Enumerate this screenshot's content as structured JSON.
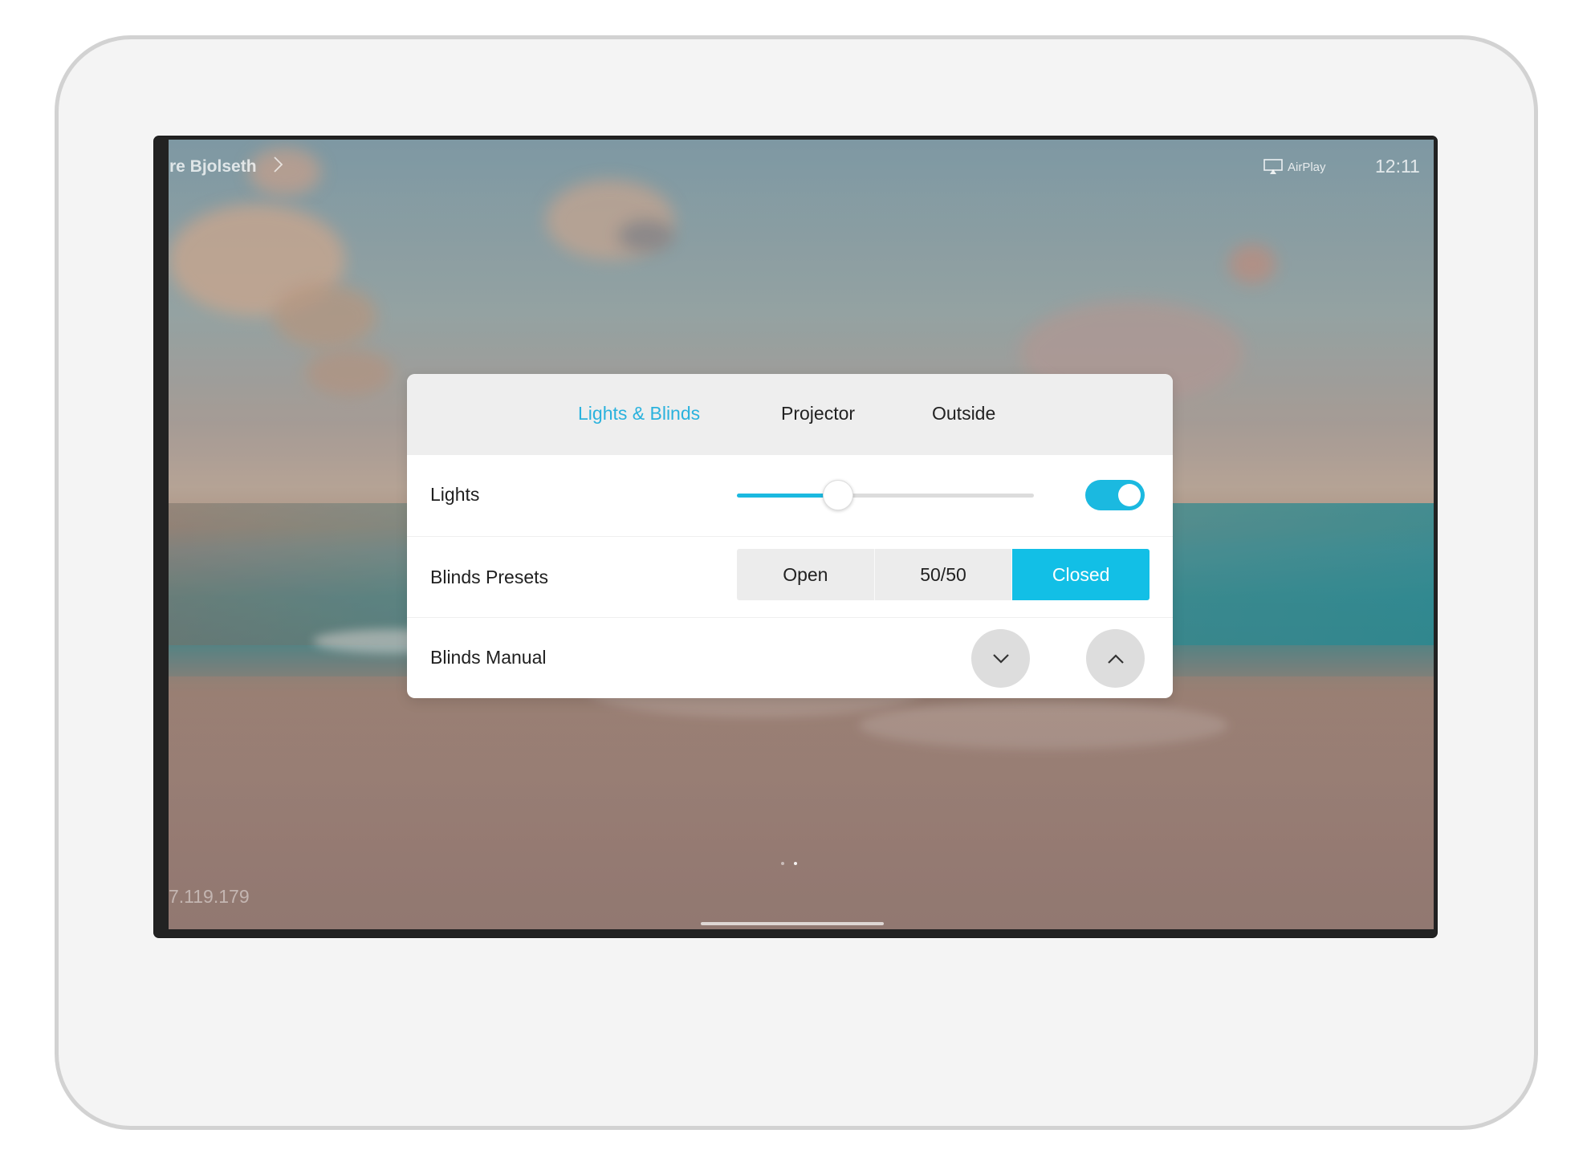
{
  "status_bar": {
    "user_name": "re Bjolseth",
    "airplay_label": "AirPlay",
    "time": "12:11",
    "ip_address": "7.119.179"
  },
  "panel": {
    "tabs": [
      {
        "label": "Lights & Blinds",
        "active": true
      },
      {
        "label": "Projector",
        "active": false
      },
      {
        "label": "Outside",
        "active": false
      }
    ],
    "lights": {
      "label": "Lights",
      "level_fraction": 0.34,
      "switch_on": true
    },
    "blinds_presets": {
      "label": "Blinds Presets",
      "options": [
        "Open",
        "50/50",
        "Closed"
      ],
      "selected": "Closed"
    },
    "blinds_manual": {
      "label": "Blinds Manual",
      "down_icon": "chevron-down-icon",
      "up_icon": "chevron-up-icon"
    }
  },
  "colors": {
    "accent": "#1bb9e0",
    "selected_segment": "#12bfe6",
    "panel_header": "#eeeeee"
  }
}
